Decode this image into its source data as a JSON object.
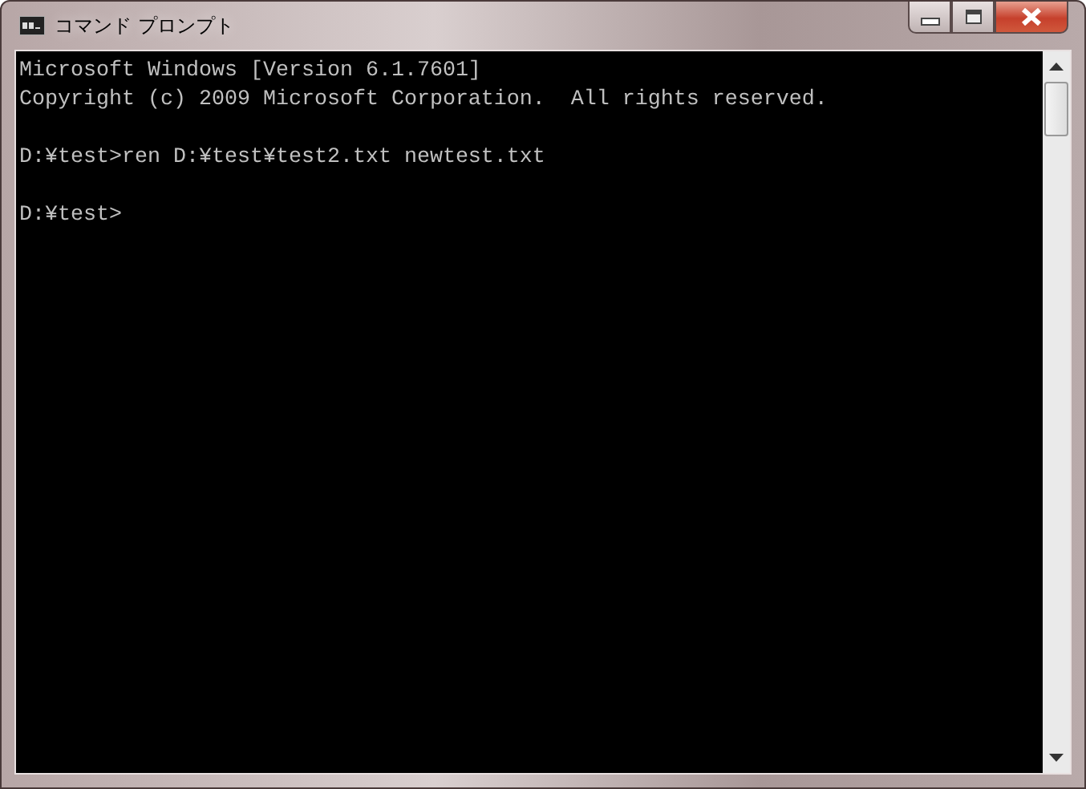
{
  "window": {
    "title": "コマンド プロンプト"
  },
  "console": {
    "blocks": [
      [
        "Microsoft Windows [Version 6.1.7601]",
        "Copyright (c) 2009 Microsoft Corporation.  All rights reserved."
      ],
      [
        "D:¥test>ren D:¥test¥test2.txt newtest.txt"
      ],
      [
        "D:¥test>"
      ]
    ]
  }
}
